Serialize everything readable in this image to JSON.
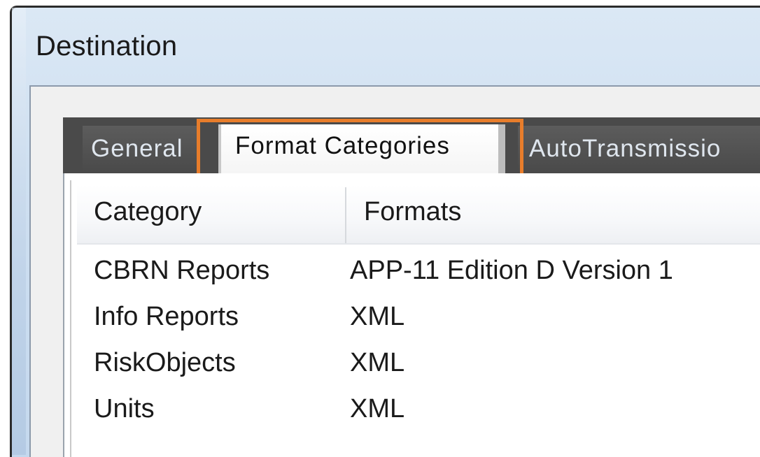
{
  "window": {
    "title": "Destination"
  },
  "tabs": [
    {
      "label": "General",
      "selected": false
    },
    {
      "label": "Format Categories",
      "selected": true
    },
    {
      "label": "AutoTransmissio",
      "selected": false
    }
  ],
  "list": {
    "columns": [
      "Category",
      "Formats"
    ],
    "rows": [
      {
        "category": "CBRN Reports",
        "format": "APP-11 Edition D Version 1"
      },
      {
        "category": "Info Reports",
        "format": "XML"
      },
      {
        "category": "RiskObjects",
        "format": "XML"
      },
      {
        "category": "Units",
        "format": "XML"
      }
    ]
  },
  "colors": {
    "highlight": "#e87d2b",
    "tab_strip": "#4a4a4a",
    "title_bar": "#cfe0f1"
  }
}
